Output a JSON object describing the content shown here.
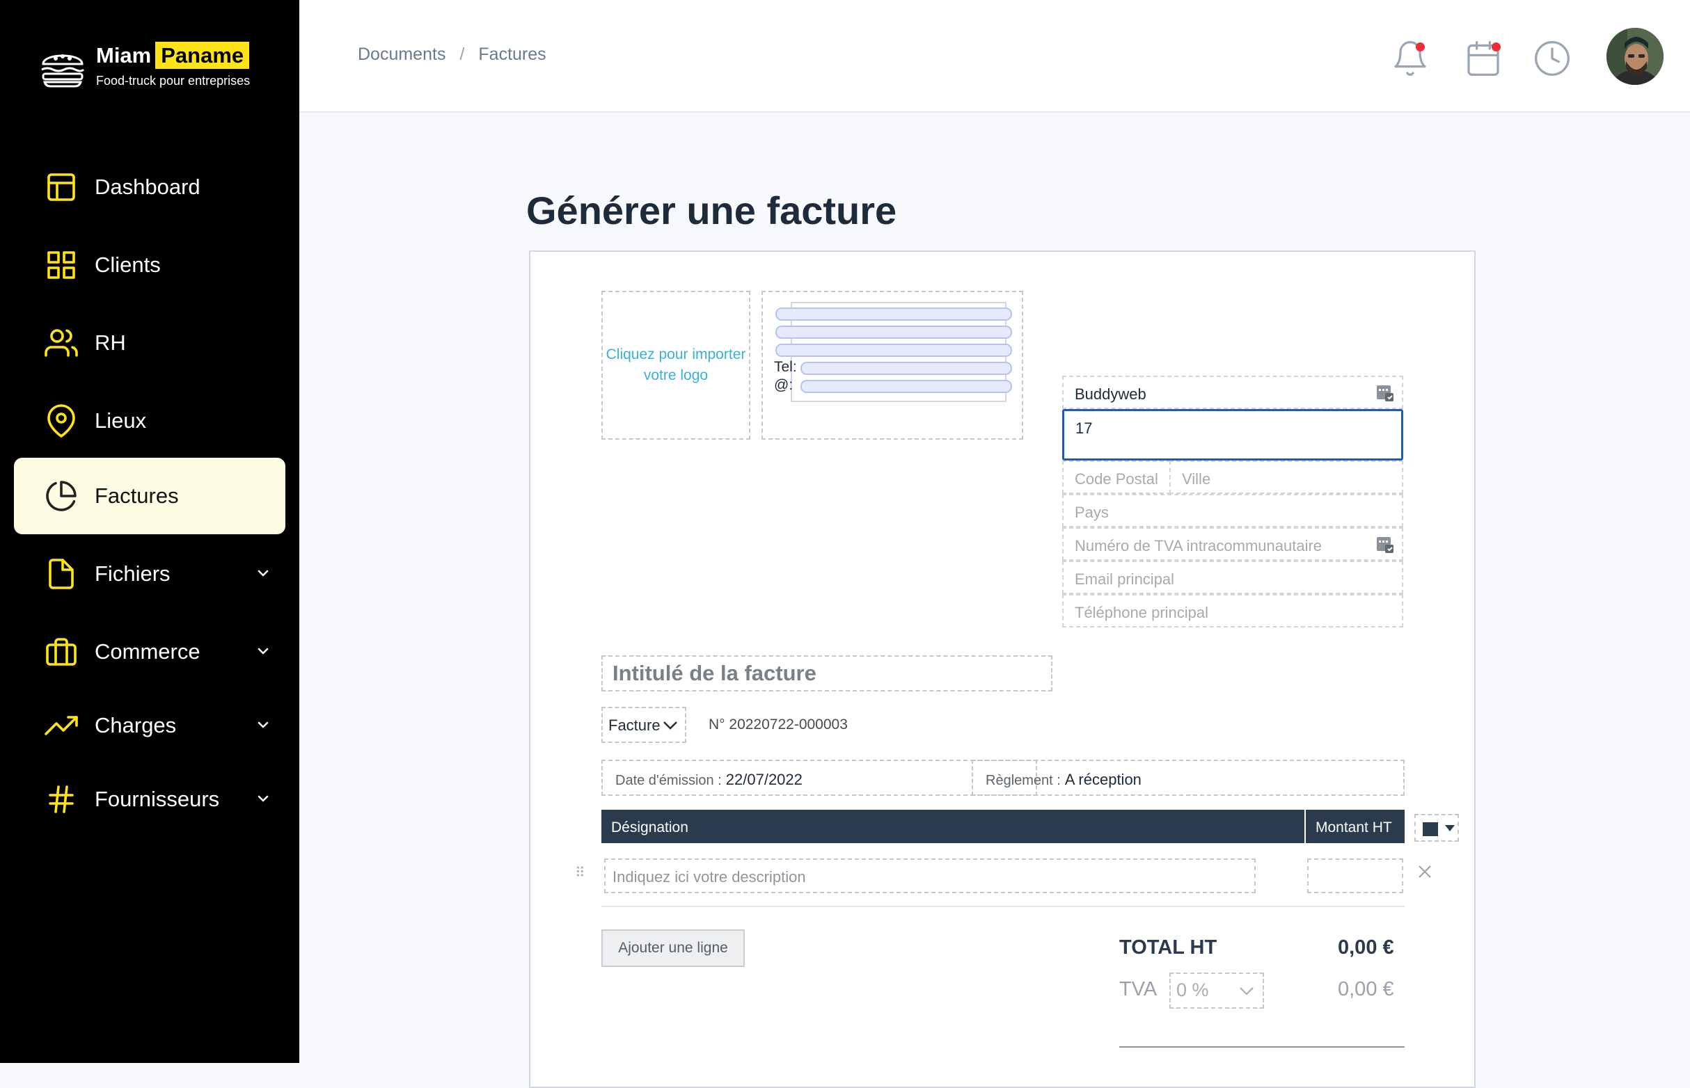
{
  "brand": {
    "name": "Miam",
    "highlight": "Paname",
    "tagline": "Food-truck pour entreprises"
  },
  "sidebar": {
    "items": [
      {
        "label": "Dashboard",
        "icon": "layout-icon"
      },
      {
        "label": "Clients",
        "icon": "grid-icon"
      },
      {
        "label": "RH",
        "icon": "users-icon"
      },
      {
        "label": "Lieux",
        "icon": "map-pin-icon"
      },
      {
        "label": "Factures",
        "icon": "pie-chart-icon",
        "active": true
      },
      {
        "label": "Fichiers",
        "icon": "file-icon",
        "expandable": true
      },
      {
        "label": "Commerce",
        "icon": "briefcase-icon",
        "expandable": true
      },
      {
        "label": "Charges",
        "icon": "trending-up-icon",
        "expandable": true
      },
      {
        "label": "Fournisseurs",
        "icon": "hash-icon",
        "expandable": true
      }
    ]
  },
  "breadcrumb": {
    "root": "Documents",
    "separator": "/",
    "current": "Factures"
  },
  "colors": {
    "accent": "#ffe415",
    "sidebar_bg": "#000000",
    "active_bg": "#fefde3",
    "table_header": "#2b3a4d",
    "focus": "#1f5bb5",
    "notification_dot": "#ee2d3a",
    "link": "#3ab0d8"
  },
  "page": {
    "title": "Générer une facture"
  },
  "invoice": {
    "logo_prompt": "Cliquez pour importer votre logo",
    "sender": {
      "tel_label": "Tel:",
      "email_label": "@:"
    },
    "client": {
      "name": "Buddyweb",
      "address": "17",
      "postal_placeholder": "Code Postal",
      "city_placeholder": "Ville",
      "country_placeholder": "Pays",
      "vat_placeholder": "Numéro de TVA intracommunautaire",
      "email_placeholder": "Email principal",
      "phone_placeholder": "Téléphone principal"
    },
    "title_placeholder": "Intitulé de la facture",
    "type": "Facture",
    "number": "N° 20220722-000003",
    "issue_date_label": "Date d'émission :",
    "issue_date": "22/07/2022",
    "payment_label": "Règlement :",
    "payment": "A réception",
    "table": {
      "col_designation": "Désignation",
      "col_amount": "Montant HT",
      "desc_placeholder": "Indiquez ici votre description"
    },
    "add_line": "Ajouter une ligne",
    "total_ht_label": "TOTAL HT",
    "total_ht": "0,00 €",
    "tva_label": "TVA",
    "tva_rate": "0 %",
    "tva_amount": "0,00 €"
  }
}
